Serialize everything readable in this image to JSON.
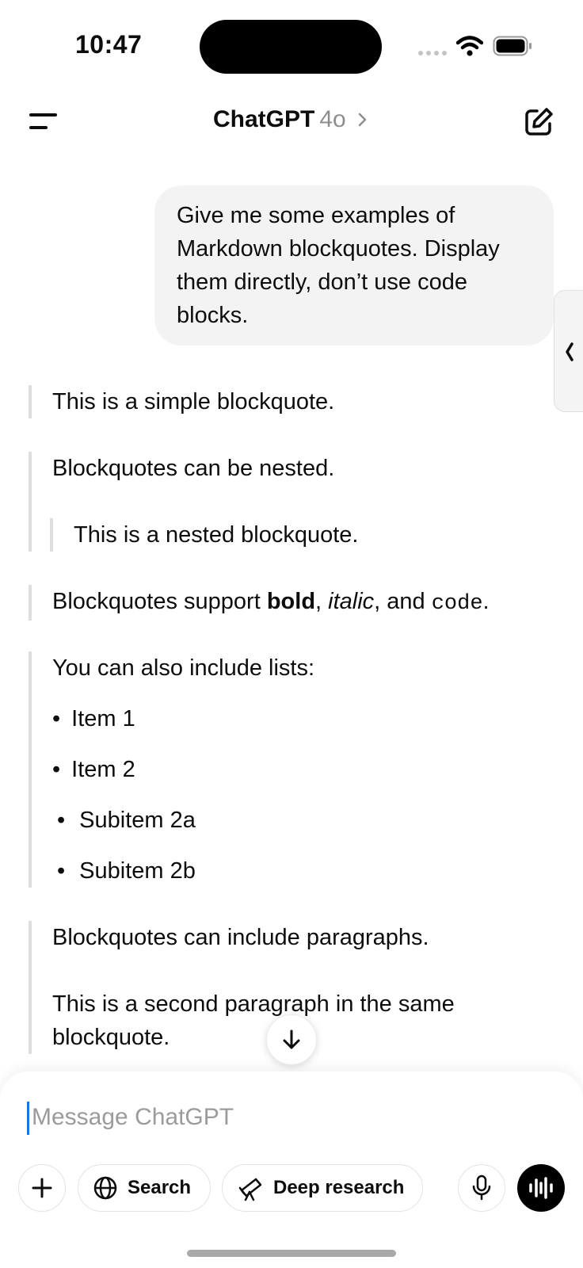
{
  "status_bar": {
    "time": "10:47"
  },
  "header": {
    "title": "ChatGPT",
    "model": "4o"
  },
  "user_message": "Give me some examples of Markdown blockquotes. Display them directly, don’t use code blocks.",
  "response": {
    "simple": "This is a simple blockquote.",
    "nested_outer": "Blockquotes can be nested.",
    "nested_inner": "This is a nested blockquote.",
    "formatting": {
      "prefix": "Blockquotes support ",
      "bold": "bold",
      "sep1": ", ",
      "italic": "italic",
      "sep2": ", and ",
      "code": "code",
      "suffix": "."
    },
    "lists_intro": "You can also include lists:",
    "list_items": [
      "Item 1",
      "Item 2",
      "Subitem 2a",
      "Subitem 2b"
    ],
    "paragraph1": "Blockquotes can include paragraphs.",
    "paragraph2": "This is a second paragraph in the same blockquote."
  },
  "composer": {
    "placeholder": "Message ChatGPT",
    "search_label": "Search",
    "deep_research_label": "Deep research"
  },
  "icons": [
    "menu-icon",
    "new-chat-icon",
    "chevron-right-icon",
    "chevron-left-icon",
    "arrow-down-icon",
    "plus-icon",
    "globe-icon",
    "telescope-icon",
    "microphone-icon",
    "voice-waveform-icon",
    "wifi-icon",
    "battery-icon"
  ]
}
